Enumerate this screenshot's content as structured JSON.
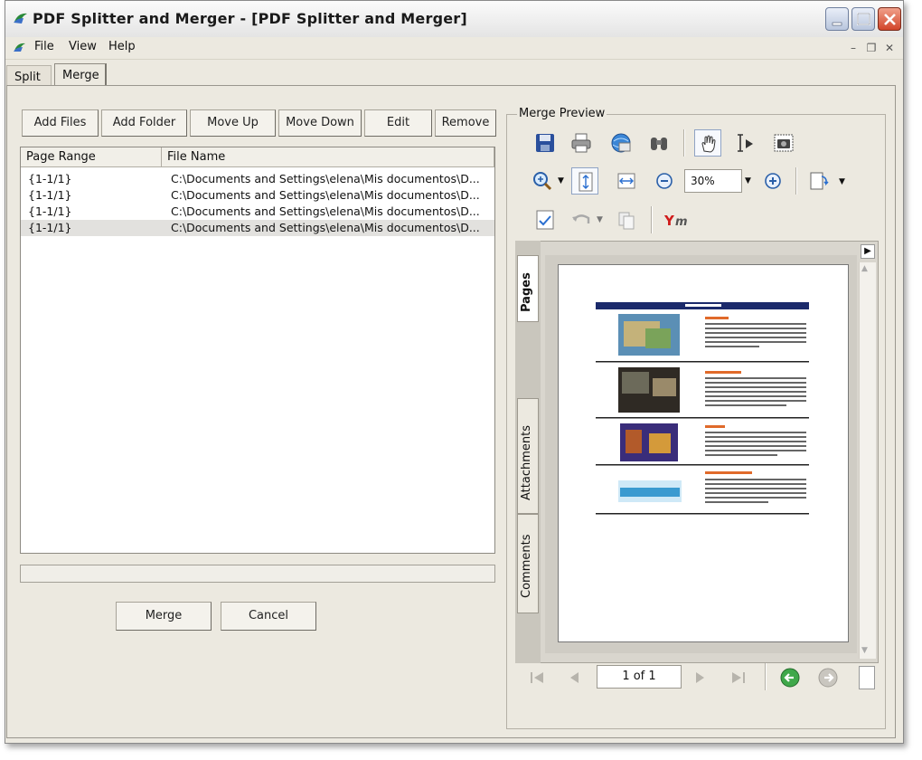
{
  "window": {
    "title": "PDF Splitter and  Merger - [PDF Splitter and Merger]"
  },
  "menu": {
    "items": [
      "File",
      "View",
      "Help"
    ]
  },
  "tabs": {
    "split": "Split",
    "merge": "Merge"
  },
  "toolbar": {
    "add_files": "Add Files",
    "add_folder": "Add Folder",
    "move_up": "Move Up",
    "move_down": "Move Down",
    "edit": "Edit",
    "remove": "Remove"
  },
  "file_list": {
    "columns": [
      "Page Range",
      "File Name"
    ],
    "rows": [
      {
        "range": "{1-1/1}",
        "file": "C:\\Documents and Settings\\elena\\Mis documentos\\D..."
      },
      {
        "range": "{1-1/1}",
        "file": "C:\\Documents and Settings\\elena\\Mis documentos\\D..."
      },
      {
        "range": "{1-1/1}",
        "file": "C:\\Documents and Settings\\elena\\Mis documentos\\D..."
      },
      {
        "range": "{1-1/1}",
        "file": "C:\\Documents and Settings\\elena\\Mis documentos\\D..."
      }
    ]
  },
  "actions": {
    "merge": "Merge",
    "cancel": "Cancel"
  },
  "preview": {
    "label": "Merge Preview",
    "zoom": "30%",
    "side_tabs": [
      "Pages",
      "Attachments",
      "Comments"
    ],
    "page_indicator": "1 of 1"
  },
  "colors": {
    "accent_blue": "#1f5fb8",
    "page_header_navy": "#1b2a6b",
    "close_red": "#d2452a"
  }
}
